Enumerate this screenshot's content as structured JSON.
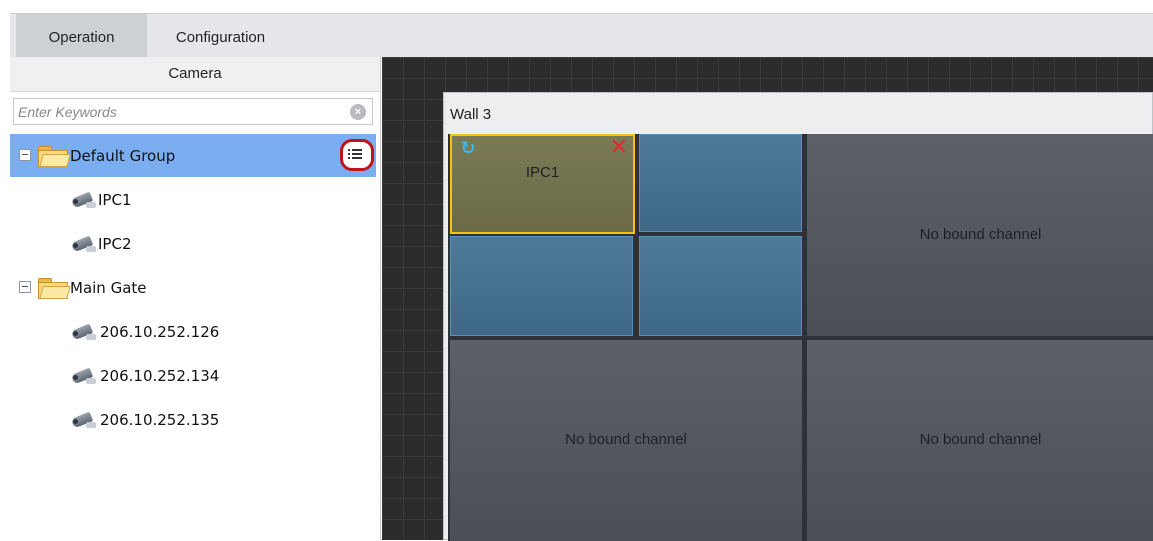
{
  "tabs": [
    {
      "label": "Operation"
    },
    {
      "label": "Configuration"
    }
  ],
  "sidebar": {
    "header": "Camera",
    "search": {
      "placeholder": "Enter Keywords",
      "value": ""
    },
    "tree": [
      {
        "type": "group",
        "label": "Default Group",
        "selected": true
      },
      {
        "type": "camera",
        "label": "IPC1"
      },
      {
        "type": "camera",
        "label": "IPC2"
      },
      {
        "type": "group",
        "label": "Main Gate"
      },
      {
        "type": "camera",
        "label": "206.10.252.126"
      },
      {
        "type": "camera",
        "label": "206.10.252.134"
      },
      {
        "type": "camera",
        "label": "206.10.252.135"
      }
    ]
  },
  "wall": {
    "title": "Wall 3",
    "tiles": [
      {
        "label": "IPC1",
        "state": "active"
      },
      {
        "label": "",
        "state": "bound"
      },
      {
        "label": "",
        "state": "bound"
      },
      {
        "label": "",
        "state": "bound"
      },
      {
        "label": "No bound channel",
        "state": "empty"
      },
      {
        "label": "No bound channel",
        "state": "empty"
      },
      {
        "label": "No bound channel",
        "state": "empty"
      }
    ]
  },
  "colors": {
    "selection": "#7aaef0",
    "active_tile_border": "#f2c50f",
    "highlight_ring": "#c0141a",
    "canvas_bg": "#2c2c2c"
  }
}
